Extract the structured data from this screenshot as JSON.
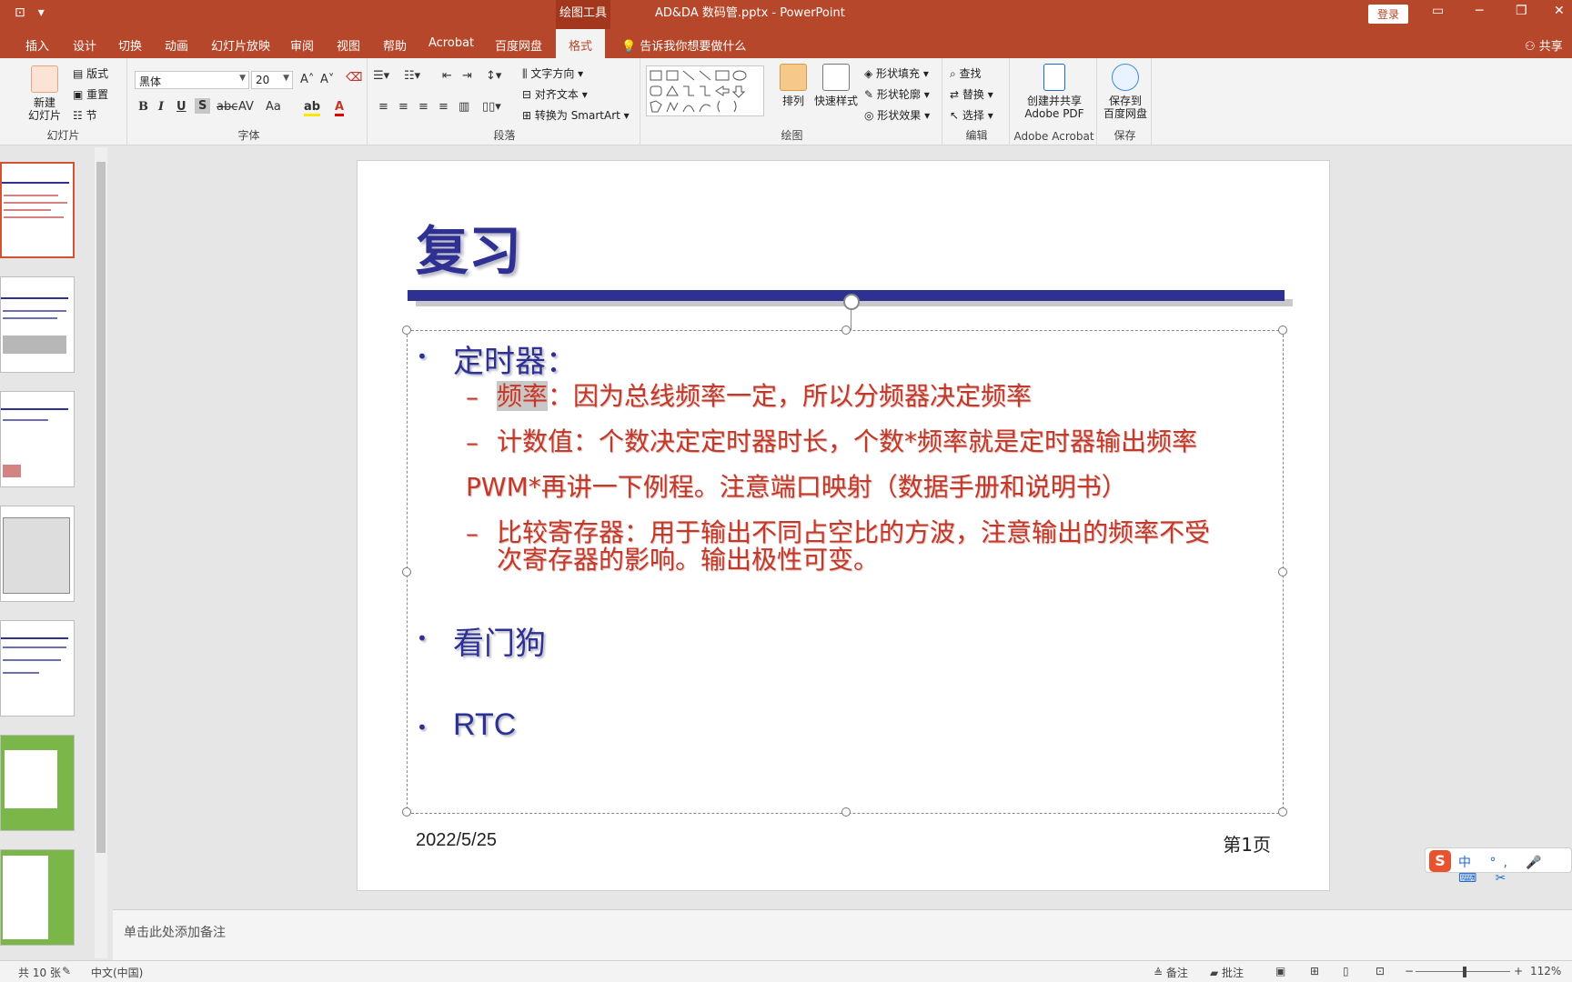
{
  "titlebar": {
    "drawing_tools": "绘图工具",
    "window_title": "AD&DA 数码管.pptx  -  PowerPoint",
    "login": "登录"
  },
  "tabs": {
    "insert": "插入",
    "design": "设计",
    "transitions": "切换",
    "animations": "动画",
    "slideshow": "幻灯片放映",
    "review": "审阅",
    "view": "视图",
    "help": "帮助",
    "acrobat": "Acrobat",
    "baidu": "百度网盘",
    "format": "格式",
    "tellme": "告诉我你想要做什么",
    "share": "共享"
  },
  "ribbon": {
    "slides": {
      "new_slide": "新建\n幻灯片",
      "layout": "版式",
      "reset": "重置",
      "section": "节",
      "label": "幻灯片"
    },
    "font": {
      "family": "黑体",
      "size": "20",
      "label": "字体"
    },
    "paragraph": {
      "text_direction": "文字方向",
      "align_text": "对齐文本",
      "smartart": "转换为 SmartArt",
      "label": "段落"
    },
    "drawing": {
      "arrange": "排列",
      "quick_styles": "快速样式",
      "shape_fill": "形状填充",
      "shape_outline": "形状轮廓",
      "shape_effects": "形状效果",
      "label": "绘图"
    },
    "editing": {
      "find": "查找",
      "replace": "替换",
      "select": "选择",
      "label": "编辑"
    },
    "acrobat": {
      "create_share": "创建并共享\nAdobe PDF",
      "label": "Adobe Acrobat"
    },
    "save": {
      "save_baidu": "保存到\n百度网盘",
      "label": "保存"
    }
  },
  "slide": {
    "title": "复习",
    "bullet1": "定时器：",
    "sub1_hl": "频率",
    "sub1_rest": "：因为总线频率一定，所以分频器决定频率",
    "sub2": "计数值：个数决定定时器时长，个数*频率就是定时器输出频率",
    "pwm": "PWM*再讲一下例程。注意端口映射（数据手册和说明书）",
    "sub3_line1": "比较寄存器：用于输出不同占空比的方波，注意输出的频率不受",
    "sub3_line2": "次寄存器的影响。输出极性可变。",
    "bullet2": "看门狗",
    "bullet3": "RTC",
    "date": "2022/5/25",
    "page": "第1页"
  },
  "notes": {
    "placeholder": "单击此处添加备注"
  },
  "ime": {
    "logo": "S",
    "items": "中 °, 🎤 ⌨ ✂"
  },
  "status": {
    "slide_count": "共 10 张",
    "language": "中文(中国)",
    "notes": "备注",
    "comments": "批注",
    "zoom": "112%"
  },
  "colors": {
    "app_accent": "#b7472a",
    "slide_title": "#2e3192",
    "sub_text": "#c0392b"
  }
}
